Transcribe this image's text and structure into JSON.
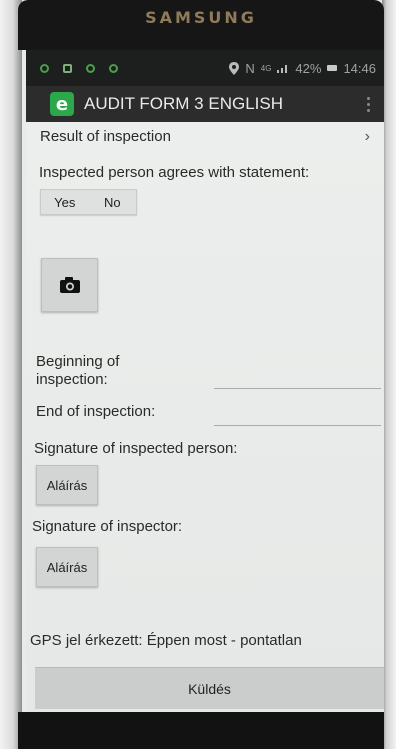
{
  "device": {
    "brand": "SAMSUNG"
  },
  "status_bar": {
    "notification_icons": [
      "notification-icon",
      "image-notification-icon",
      "notification-icon",
      "notification-icon"
    ],
    "system_icons": [
      "location-icon",
      "nfc-icon",
      "network-4g-icon",
      "signal-icon"
    ],
    "nfc_label": "N",
    "network_label": "4G",
    "battery": "42%",
    "time": "14:46"
  },
  "app_bar": {
    "logo_letter": "e",
    "title": "AUDIT FORM 3 ENGLISH",
    "menu_icon": "overflow-menu-icon"
  },
  "form": {
    "result_row": {
      "label": "Result of inspection",
      "chevron": "›"
    },
    "agree_label": "Inspected person agrees with statement:",
    "agree_options": [
      "Yes",
      "No"
    ],
    "camera_icon": "camera-icon",
    "beginning_label": "Beginning of inspection:",
    "beginning_value": "",
    "end_label": "End of inspection:",
    "end_value": "",
    "signature_person_label": "Signature of inspected person:",
    "signature_person_button": "Aláírás",
    "signature_inspector_label": "Signature of inspector:",
    "signature_inspector_button": "Aláírás",
    "gps_status": "GPS jel érkezett: Éppen most - pontatlan",
    "send_button": "Küldés"
  },
  "colors": {
    "app_logo": "#2aa84a",
    "app_bar": "#2b2c2b",
    "status_bar": "#1d1f1e",
    "content_bg": "#eceeed"
  }
}
